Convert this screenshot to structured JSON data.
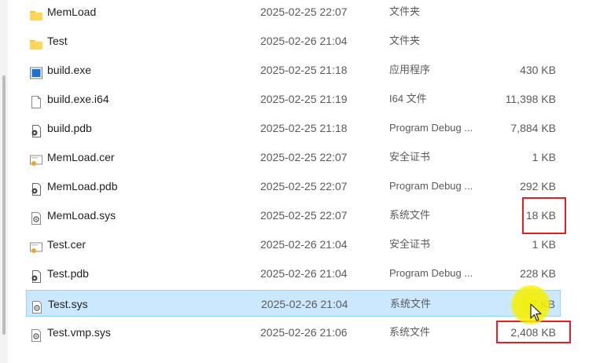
{
  "files": [
    {
      "name": "MemLoad",
      "modified": "2025-02-25 22:07",
      "type": "文件夹",
      "size": "",
      "icon": "folder-icon"
    },
    {
      "name": "Test",
      "modified": "2025-02-26 21:04",
      "type": "文件夹",
      "size": "",
      "icon": "folder-icon"
    },
    {
      "name": "build.exe",
      "modified": "2025-02-25 21:18",
      "type": "应用程序",
      "size": "430 KB",
      "icon": "exe-icon"
    },
    {
      "name": "build.exe.i64",
      "modified": "2025-02-25 21:19",
      "type": "I64 文件",
      "size": "11,398 KB",
      "icon": "file-icon"
    },
    {
      "name": "build.pdb",
      "modified": "2025-02-25 21:18",
      "type": "Program Debug ...",
      "size": "7,884 KB",
      "icon": "pdb-icon"
    },
    {
      "name": "MemLoad.cer",
      "modified": "2025-02-25 22:07",
      "type": "安全证书",
      "size": "1 KB",
      "icon": "certificate-icon"
    },
    {
      "name": "MemLoad.pdb",
      "modified": "2025-02-25 22:07",
      "type": "Program Debug ...",
      "size": "292 KB",
      "icon": "pdb-icon"
    },
    {
      "name": "MemLoad.sys",
      "modified": "2025-02-25 22:07",
      "type": "系统文件",
      "size": "18 KB",
      "icon": "sys-icon"
    },
    {
      "name": "Test.cer",
      "modified": "2025-02-26 21:04",
      "type": "安全证书",
      "size": "1 KB",
      "icon": "certificate-icon"
    },
    {
      "name": "Test.pdb",
      "modified": "2025-02-26 21:04",
      "type": "Program Debug ...",
      "size": "228 KB",
      "icon": "pdb-icon"
    },
    {
      "name": "Test.sys",
      "modified": "2025-02-26 21:04",
      "type": "系统文件",
      "size": "7 KB",
      "icon": "sys-icon",
      "selected": true
    },
    {
      "name": "Test.vmp.sys",
      "modified": "2025-02-26 21:06",
      "type": "系统文件",
      "size": "2,408 KB",
      "icon": "sys-icon"
    }
  ],
  "colors": {
    "selection": "#cce8ff",
    "highlight_box": "#e0202b",
    "cursor_spot": "#f5f000"
  }
}
